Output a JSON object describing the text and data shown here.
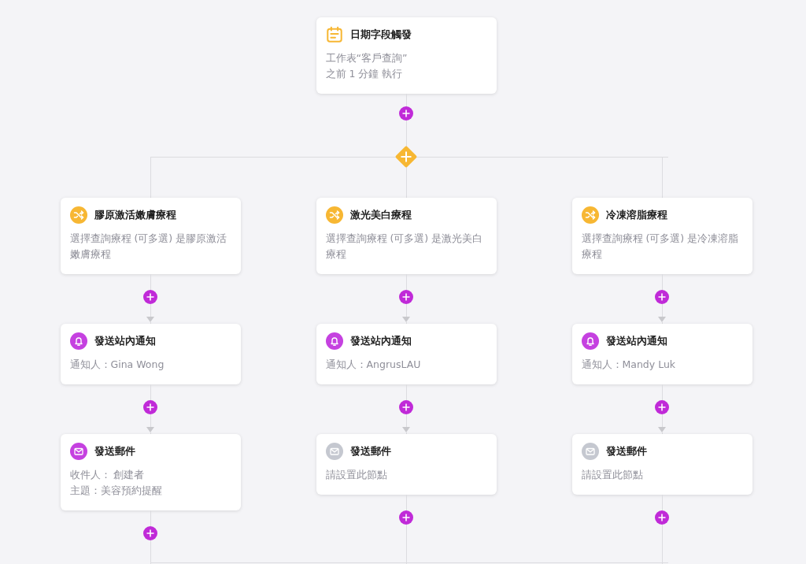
{
  "trigger": {
    "kind": "date_trigger",
    "title": "日期字段觸發",
    "lines": [
      "工作表“客戶查詢”",
      "之前 1 分鐘 執行"
    ]
  },
  "branches": [
    {
      "nodes": [
        {
          "kind": "condition",
          "title": "膠原激活嫩膚療程",
          "lines": [
            "選擇查詢療程 (可多選) 是膠原激活嫩膚療程"
          ]
        },
        {
          "kind": "notification",
          "title": "發送站內通知",
          "lines": [
            "通知人：Gina Wong"
          ]
        },
        {
          "kind": "email",
          "configured": true,
          "title": "發送郵件",
          "lines": [
            "收件人： 創建者",
            "主題：美容預約提醒"
          ]
        }
      ]
    },
    {
      "nodes": [
        {
          "kind": "condition",
          "title": "激光美白療程",
          "lines": [
            "選擇查詢療程 (可多選) 是激光美白療程"
          ]
        },
        {
          "kind": "notification",
          "title": "發送站內通知",
          "lines": [
            "通知人：AngrusLAU"
          ]
        },
        {
          "kind": "email",
          "configured": false,
          "title": "發送郵件",
          "lines": [
            "請設置此節點"
          ]
        }
      ]
    },
    {
      "nodes": [
        {
          "kind": "condition",
          "title": "冷凍溶脂療程",
          "lines": [
            "選擇查詢療程 (可多選) 是冷凍溶脂療程"
          ]
        },
        {
          "kind": "notification",
          "title": "發送站內通知",
          "lines": [
            "通知人：Mandy Luk"
          ]
        },
        {
          "kind": "email",
          "configured": false,
          "title": "發送郵件",
          "lines": [
            "請設置此節點"
          ]
        }
      ]
    }
  ]
}
